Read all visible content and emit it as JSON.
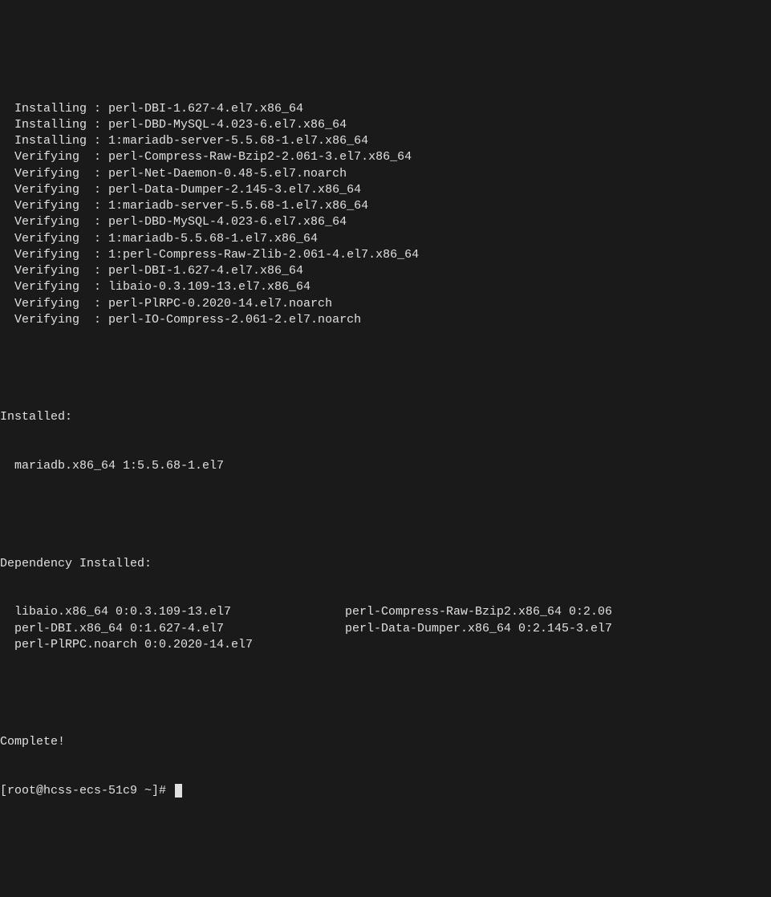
{
  "install_lines": [
    {
      "action": "Installing",
      "pkg": "perl-DBI-1.627-4.el7.x86_64"
    },
    {
      "action": "Installing",
      "pkg": "perl-DBD-MySQL-4.023-6.el7.x86_64"
    },
    {
      "action": "Installing",
      "pkg": "1:mariadb-server-5.5.68-1.el7.x86_64"
    },
    {
      "action": "Verifying",
      "pkg": "perl-Compress-Raw-Bzip2-2.061-3.el7.x86_64"
    },
    {
      "action": "Verifying",
      "pkg": "perl-Net-Daemon-0.48-5.el7.noarch"
    },
    {
      "action": "Verifying",
      "pkg": "perl-Data-Dumper-2.145-3.el7.x86_64"
    },
    {
      "action": "Verifying",
      "pkg": "1:mariadb-server-5.5.68-1.el7.x86_64"
    },
    {
      "action": "Verifying",
      "pkg": "perl-DBD-MySQL-4.023-6.el7.x86_64"
    },
    {
      "action": "Verifying",
      "pkg": "1:mariadb-5.5.68-1.el7.x86_64"
    },
    {
      "action": "Verifying",
      "pkg": "1:perl-Compress-Raw-Zlib-2.061-4.el7.x86_64"
    },
    {
      "action": "Verifying",
      "pkg": "perl-DBI-1.627-4.el7.x86_64"
    },
    {
      "action": "Verifying",
      "pkg": "libaio-0.3.109-13.el7.x86_64"
    },
    {
      "action": "Verifying",
      "pkg": "perl-PlRPC-0.2020-14.el7.noarch"
    },
    {
      "action": "Verifying",
      "pkg": "perl-IO-Compress-2.061-2.el7.noarch"
    }
  ],
  "sections": {
    "installed_header": "Installed:",
    "installed_pkgs": "mariadb.x86_64 1:5.5.68-1.el7",
    "dep_installed_header": "Dependency Installed:",
    "dep_rows": [
      {
        "c1": "libaio.x86_64 0:0.3.109-13.el7",
        "c2": "perl-Compress-Raw-Bzip2.x86_64 0:2.06"
      },
      {
        "c1": "perl-DBI.x86_64 0:1.627-4.el7",
        "c2": "perl-Data-Dumper.x86_64 0:2.145-3.el7"
      },
      {
        "c1": "perl-PlRPC.noarch 0:0.2020-14.el7",
        "c2": ""
      }
    ],
    "complete": "Complete!",
    "prompt": "[root@hcss-ecs-51c9 ~]#"
  }
}
